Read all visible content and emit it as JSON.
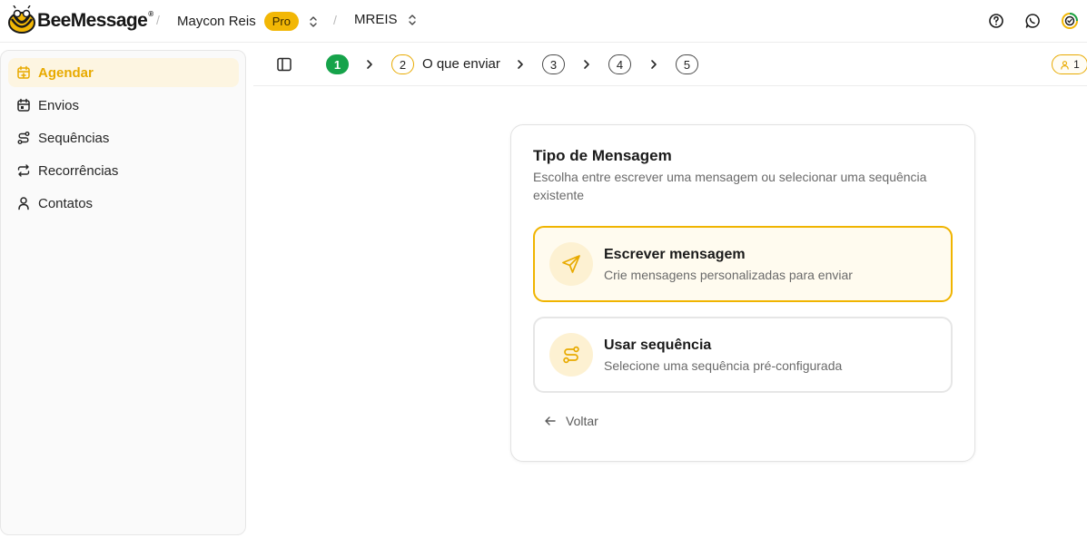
{
  "header": {
    "logo_text": "BeeMessage",
    "logo_reg": "®",
    "workspace": "Maycon Reis",
    "plan_badge": "Pro",
    "project": "MREIS",
    "icons": [
      "help-icon",
      "whatsapp-icon",
      "profile-progress-icon"
    ]
  },
  "sidebar": {
    "items": [
      {
        "label": "Agendar",
        "icon": "calendar-plus-icon",
        "active": true
      },
      {
        "label": "Envios",
        "icon": "calendar-icon",
        "active": false
      },
      {
        "label": "Sequências",
        "icon": "route-icon",
        "active": false
      },
      {
        "label": "Recorrências",
        "icon": "repeat-icon",
        "active": false
      },
      {
        "label": "Contatos",
        "icon": "user-icon",
        "active": false
      }
    ]
  },
  "stepper": {
    "steps": [
      {
        "number": "1",
        "label": "",
        "state": "done"
      },
      {
        "number": "2",
        "label": "O que enviar",
        "state": "current"
      },
      {
        "number": "3",
        "label": "",
        "state": "pending"
      },
      {
        "number": "4",
        "label": "",
        "state": "pending"
      },
      {
        "number": "5",
        "label": "",
        "state": "pending"
      }
    ],
    "contacts_count": "1"
  },
  "card": {
    "title": "Tipo de Mensagem",
    "description": "Escolha entre escrever uma mensagem ou selecionar uma sequência existente",
    "options": [
      {
        "title": "Escrever mensagem",
        "description": "Crie mensagens personalizadas para enviar",
        "icon": "send-icon",
        "selected": true
      },
      {
        "title": "Usar sequência",
        "description": "Selecione uma sequência pré-configurada",
        "icon": "route-icon",
        "selected": false
      }
    ],
    "back_label": "Voltar"
  },
  "colors": {
    "accent": "#f0b400",
    "done": "#16a34a",
    "active_bg": "#fdf5e1"
  }
}
